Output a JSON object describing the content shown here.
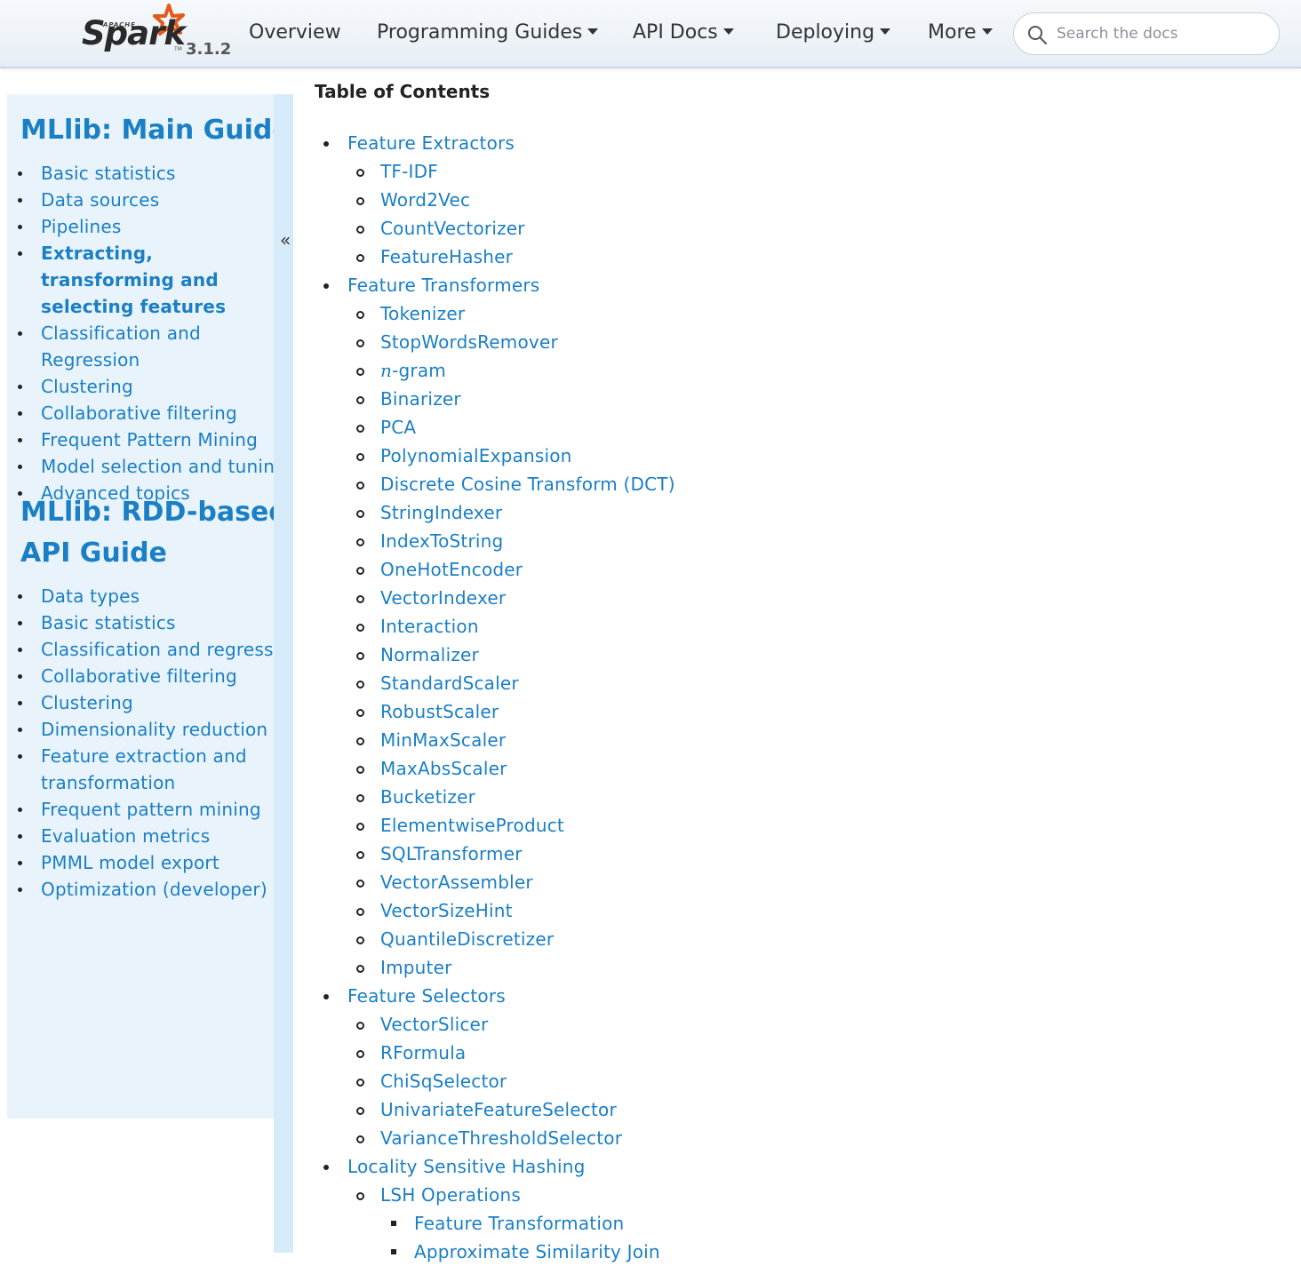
{
  "header": {
    "logo": {
      "apache": "APACHE",
      "spark": "Spark",
      "tm": "TM",
      "version": "3.1.2"
    },
    "nav": [
      {
        "label": "Overview",
        "dropdown": false
      },
      {
        "label": "Programming Guides",
        "dropdown": true
      },
      {
        "label": "API Docs",
        "dropdown": true
      },
      {
        "label": "Deploying",
        "dropdown": true
      },
      {
        "label": "More",
        "dropdown": true
      }
    ],
    "search": {
      "placeholder": "Search the docs",
      "value": ""
    }
  },
  "sidebar": {
    "main_title": "MLlib: Main Guide",
    "main_items": [
      "Basic statistics",
      "Data sources",
      "Pipelines",
      "Extracting, transforming and selecting features",
      "Classification and Regression",
      "Clustering",
      "Collaborative filtering",
      "Frequent Pattern Mining",
      "Model selection and tuning",
      "Advanced topics"
    ],
    "rdd_title_line1": "MLlib: RDD-based",
    "rdd_title_line2": "API Guide",
    "rdd_items": [
      "Data types",
      "Basic statistics",
      "Classification and regression",
      "Collaborative filtering",
      "Clustering",
      "Dimensionality reduction",
      "Feature extraction and transformation",
      "Frequent pattern mining",
      "Evaluation metrics",
      "PMML model export",
      "Optimization (developer)"
    ],
    "collapse_label": "«"
  },
  "main": {
    "toc_title": "Table of Contents",
    "toc": [
      {
        "level": 1,
        "label": "Feature Extractors"
      },
      {
        "level": 2,
        "label": "TF-IDF"
      },
      {
        "level": 2,
        "label": "Word2Vec"
      },
      {
        "level": 2,
        "label": "CountVectorizer"
      },
      {
        "level": 2,
        "label": "FeatureHasher"
      },
      {
        "level": 1,
        "label": "Feature Transformers"
      },
      {
        "level": 2,
        "label": "Tokenizer"
      },
      {
        "level": 2,
        "label": "StopWordsRemover"
      },
      {
        "level": 2,
        "label": "-gram",
        "math_prefix": "n"
      },
      {
        "level": 2,
        "label": "Binarizer"
      },
      {
        "level": 2,
        "label": "PCA"
      },
      {
        "level": 2,
        "label": "PolynomialExpansion"
      },
      {
        "level": 2,
        "label": "Discrete Cosine Transform (DCT)"
      },
      {
        "level": 2,
        "label": "StringIndexer"
      },
      {
        "level": 2,
        "label": "IndexToString"
      },
      {
        "level": 2,
        "label": "OneHotEncoder"
      },
      {
        "level": 2,
        "label": "VectorIndexer"
      },
      {
        "level": 2,
        "label": "Interaction"
      },
      {
        "level": 2,
        "label": "Normalizer"
      },
      {
        "level": 2,
        "label": "StandardScaler"
      },
      {
        "level": 2,
        "label": "RobustScaler"
      },
      {
        "level": 2,
        "label": "MinMaxScaler"
      },
      {
        "level": 2,
        "label": "MaxAbsScaler"
      },
      {
        "level": 2,
        "label": "Bucketizer"
      },
      {
        "level": 2,
        "label": "ElementwiseProduct"
      },
      {
        "level": 2,
        "label": "SQLTransformer"
      },
      {
        "level": 2,
        "label": "VectorAssembler"
      },
      {
        "level": 2,
        "label": "VectorSizeHint"
      },
      {
        "level": 2,
        "label": "QuantileDiscretizer"
      },
      {
        "level": 2,
        "label": "Imputer"
      },
      {
        "level": 1,
        "label": "Feature Selectors"
      },
      {
        "level": 2,
        "label": "VectorSlicer"
      },
      {
        "level": 2,
        "label": "RFormula"
      },
      {
        "level": 2,
        "label": "ChiSqSelector"
      },
      {
        "level": 2,
        "label": "UnivariateFeatureSelector"
      },
      {
        "level": 2,
        "label": "VarianceThresholdSelector"
      },
      {
        "level": 1,
        "label": "Locality Sensitive Hashing"
      },
      {
        "level": 2,
        "label": "LSH Operations"
      },
      {
        "level": 3,
        "label": "Feature Transformation"
      },
      {
        "level": 3,
        "label": "Approximate Similarity Join"
      }
    ]
  },
  "colors": {
    "link": "#1a7fc4",
    "sidebar_bg": "#e8f3fb",
    "strip_bg": "#d5ebfa",
    "spark_orange": "#e25a1c"
  }
}
